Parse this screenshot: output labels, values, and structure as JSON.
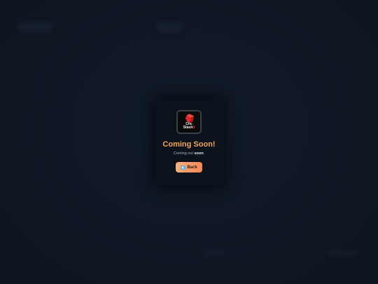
{
  "modal": {
    "logo": {
      "line1": "Cnc",
      "line2_main": "Stash",
      "line2_accent": "It",
      "icon": "red-cube-icon"
    },
    "title": "Coming Soon!",
    "subtitle_prefix": "Coming out ",
    "subtitle_emphasis": "soon",
    "subtitle_suffix": ".",
    "back_button": {
      "label": "Back",
      "icon": "back-arrow-icon"
    }
  },
  "colors": {
    "background": "#0f1724",
    "modal": "#0c121c",
    "title": "#f2a65a",
    "button_start": "#f7b27a",
    "button_end": "#f0875a",
    "logo_cube": "#e02a2a"
  }
}
